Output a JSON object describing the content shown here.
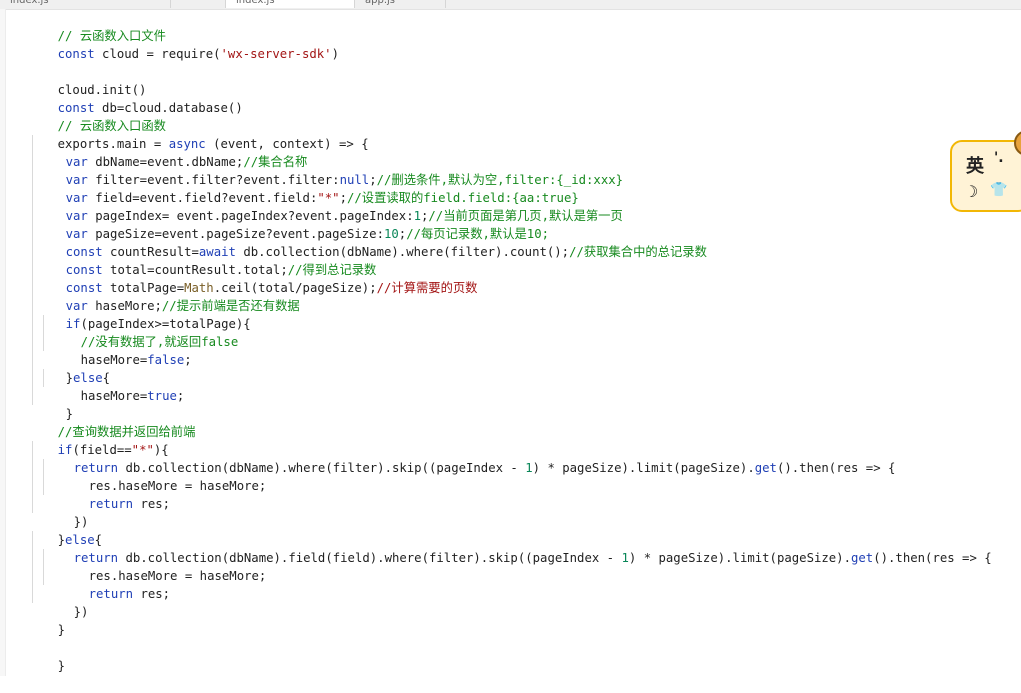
{
  "tabs": [
    {
      "label": "index.js"
    },
    {
      "label": "index.js"
    },
    {
      "label": "app.js"
    }
  ],
  "ime": {
    "char": "英",
    "dot": "'.",
    "moon": "☽",
    "shirt": "👕"
  },
  "code": {
    "l1": [
      "// 云函数入口文件"
    ],
    "l2": [
      "const",
      " cloud = require(",
      "'wx-server-sdk'",
      ")"
    ],
    "l3": [
      ""
    ],
    "l4": [
      "cloud.init()"
    ],
    "l5": [
      "const",
      " db=cloud.database()"
    ],
    "l6": [
      "// 云函数入口函数"
    ],
    "l7": [
      "exports.main = ",
      "async",
      " (event, context) => {"
    ],
    "l8": [
      "var",
      " dbName=event.dbName;",
      "//集合名称"
    ],
    "l9": [
      "var",
      " filter=event.filter?event.filter:",
      "null",
      ";",
      "//删选条件,默认为空,filter:{_id:xxx}"
    ],
    "l10": [
      "var",
      " field=event.field?event.field:",
      "\"*\"",
      ";",
      "//设置读取的field.field:{aa:true}"
    ],
    "l11": [
      "var",
      " pageIndex= event.pageIndex?event.pageIndex:",
      "1",
      ";",
      "//当前页面是第几页,默认是第一页"
    ],
    "l12": [
      "var",
      " pageSize=event.pageSize?event.pageSize:",
      "10",
      ";",
      "//每页记录数,默认是10;"
    ],
    "l13": [
      "const",
      " countResult=",
      "await",
      " db.collection(dbName).where(filter).count();",
      "//获取集合中的总记录数"
    ],
    "l14": [
      "const",
      " total=countResult.total;",
      "//得到总记录数"
    ],
    "l15": [
      "const",
      " totalPage=",
      "Math",
      ".ceil(total/pageSize);",
      "//计算需要的页数"
    ],
    "l16": [
      "var",
      " haseMore;",
      "//提示前端是否还有数据"
    ],
    "l17": [
      "if",
      "(pageIndex>=totalPage){"
    ],
    "l18": [
      "//没有数据了,就返回false"
    ],
    "l19": [
      "haseMore=",
      "false",
      ";"
    ],
    "l20": [
      "}",
      "else",
      "{"
    ],
    "l21": [
      "haseMore=",
      "true",
      ";"
    ],
    "l22": [
      "}"
    ],
    "l23": [
      "//查询数据并返回给前端"
    ],
    "l24": [
      "if",
      "(field==",
      "\"*\"",
      "){"
    ],
    "l25": [
      "return",
      " db.collection(dbName).where(filter).skip((pageIndex - ",
      "1",
      ") * pageSize).limit(pageSize).",
      "get",
      "().then(res => {"
    ],
    "l26": [
      "res.haseMore = haseMore;"
    ],
    "l27": [
      "return",
      " res;"
    ],
    "l28": [
      "})"
    ],
    "l29": [
      "}",
      "else",
      "{"
    ],
    "l30": [
      "return",
      " db.collection(dbName).field(field).where(filter).skip((pageIndex - ",
      "1",
      ") * pageSize).limit(pageSize).",
      "get",
      "().then(res => {"
    ],
    "l31": [
      "res.haseMore = haseMore;"
    ],
    "l32": [
      "return",
      " res;"
    ],
    "l33": [
      "})"
    ],
    "l34": [
      "}"
    ],
    "l35": [
      ""
    ],
    "l36": [
      "}"
    ]
  }
}
